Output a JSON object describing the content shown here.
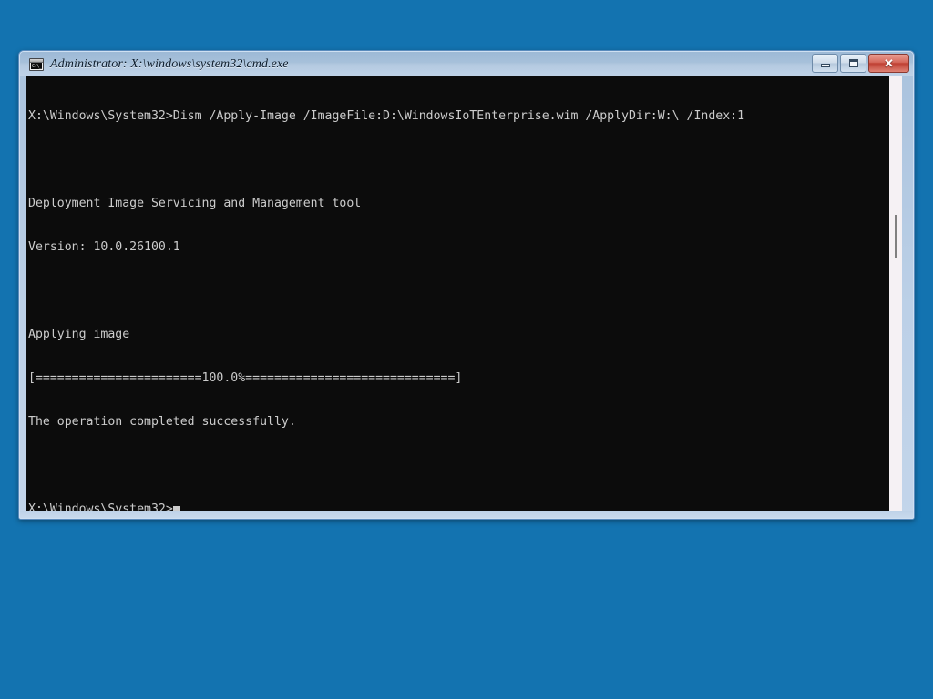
{
  "desktop": {
    "background_color": "#1373b0"
  },
  "window": {
    "title": "Administrator: X:\\windows\\system32\\cmd.exe",
    "icon_name": "cmd-console-icon",
    "icon_prompt_text": "C:\\_",
    "titlebar_gradient_top": "#9db9d6",
    "titlebar_gradient_bottom": "#c0d3e8",
    "border_color": "#5a8bbd",
    "buttons": {
      "minimize_label": "–",
      "maximize_label": "□",
      "close_label": "✕"
    }
  },
  "console": {
    "background_color": "#0c0c0c",
    "foreground_color": "#cccccc",
    "scrollbar": {
      "track_color": "#f5f1f4",
      "thumb_color": "#808080"
    },
    "lines": [
      "X:\\Windows\\System32>Dism /Apply-Image /ImageFile:D:\\WindowsIoTEnterprise.wim /ApplyDir:W:\\ /Index:1",
      "",
      "Deployment Image Servicing and Management tool",
      "Version: 10.0.26100.1",
      "",
      "Applying image",
      "[=======================100.0%=============================]",
      "The operation completed successfully.",
      ""
    ],
    "prompt": "X:\\Windows\\System32>",
    "command": "Dism /Apply-Image /ImageFile:D:\\WindowsIoTEnterprise.wim /ApplyDir:W:\\ /Index:1",
    "tool_name": "Deployment Image Servicing and Management tool",
    "tool_version": "Version: 10.0.26100.1",
    "status_applying": "Applying image",
    "progress_bar": "[=======================100.0%=============================]",
    "progress_percent": "100.0%",
    "status_complete": "The operation completed successfully."
  }
}
